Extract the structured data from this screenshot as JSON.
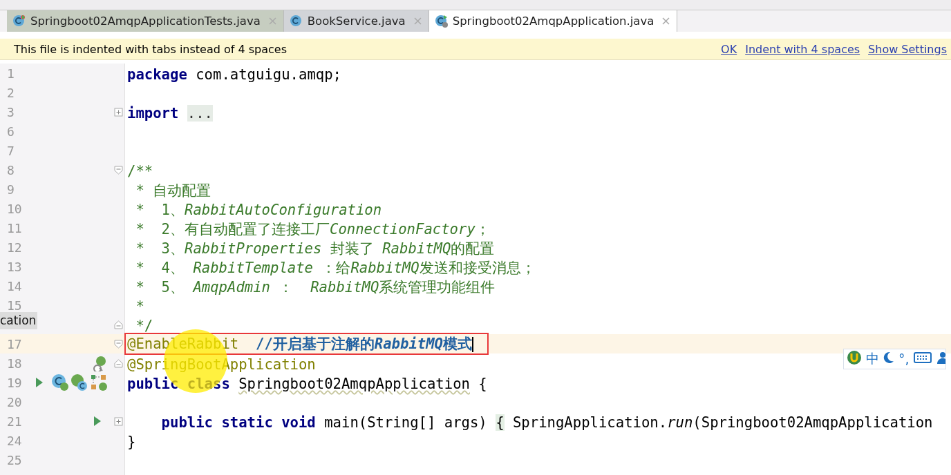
{
  "tabs": [
    {
      "label": "Springboot02AmqpApplicationTests.java",
      "selected": false
    },
    {
      "label": "BookService.java",
      "selected": false
    },
    {
      "label": "Springboot02AmqpApplication.java",
      "selected": true
    }
  ],
  "banner": {
    "message": "This file is indented with tabs instead of 4 spaces",
    "links": [
      "OK",
      "Indent with 4 spaces",
      "Show Settings"
    ]
  },
  "tooltip": {
    "text": "cation"
  },
  "lines": [
    {
      "number": "1",
      "tokens": [
        {
          "kind": "keyword",
          "text": "package"
        },
        {
          "kind": "plain",
          "text": " com.atguigu.amqp;"
        }
      ]
    },
    {
      "number": "2"
    },
    {
      "number": "3",
      "collapsed": true,
      "tokens": [
        {
          "kind": "keyword",
          "text": "import "
        },
        {
          "kind": "folded",
          "text": "..."
        }
      ]
    },
    {
      "number": "6"
    },
    {
      "number": "7"
    },
    {
      "number": "8",
      "fold_open": true,
      "tokens": [
        {
          "kind": "doc",
          "text": "/**"
        }
      ]
    },
    {
      "number": "9",
      "tokens": [
        {
          "kind": "doc",
          "text": " * 自动配置"
        }
      ]
    },
    {
      "number": "10",
      "tokens": [
        {
          "kind": "doc",
          "text": " *  1、"
        },
        {
          "kind": "doc-italic",
          "text": "RabbitAutoConfiguration"
        }
      ]
    },
    {
      "number": "11",
      "tokens": [
        {
          "kind": "doc",
          "text": " *  2、有自动配置了连接工厂"
        },
        {
          "kind": "doc-italic",
          "text": "ConnectionFactory"
        },
        {
          "kind": "doc",
          "text": "；"
        }
      ]
    },
    {
      "number": "12",
      "tokens": [
        {
          "kind": "doc",
          "text": " *  3、"
        },
        {
          "kind": "doc-italic",
          "text": "RabbitProperties"
        },
        {
          "kind": "doc",
          "text": " 封装了 "
        },
        {
          "kind": "doc-italic",
          "text": "RabbitMQ"
        },
        {
          "kind": "doc",
          "text": "的配置"
        }
      ]
    },
    {
      "number": "13",
      "tokens": [
        {
          "kind": "doc",
          "text": " *  4、 "
        },
        {
          "kind": "doc-italic",
          "text": "RabbitTemplate"
        },
        {
          "kind": "doc",
          "text": " ：给"
        },
        {
          "kind": "doc-italic",
          "text": "RabbitMQ"
        },
        {
          "kind": "doc",
          "text": "发送和接受消息；"
        }
      ]
    },
    {
      "number": "14",
      "tokens": [
        {
          "kind": "doc",
          "text": " *  5、 "
        },
        {
          "kind": "doc-italic",
          "text": "AmqpAdmin"
        },
        {
          "kind": "doc",
          "text": " ：  "
        },
        {
          "kind": "doc-italic",
          "text": "RabbitMQ"
        },
        {
          "kind": "doc",
          "text": "系统管理功能组件"
        }
      ]
    },
    {
      "number": "15",
      "tokens": [
        {
          "kind": "doc",
          "text": " *"
        }
      ]
    },
    {
      "fold_close": true,
      "tokens": [
        {
          "kind": "doc",
          "text": " */"
        }
      ]
    },
    {
      "number": "17",
      "fold_open": true,
      "current": true,
      "boxed": true,
      "tokens": [
        {
          "kind": "annotation",
          "text": "@EnableRabbit  "
        },
        {
          "kind": "comment",
          "text": "//开启基于注解的"
        },
        {
          "kind": "comment-italic",
          "text": "RabbitMQ"
        },
        {
          "kind": "comment",
          "text": "模式"
        }
      ]
    },
    {
      "number": "18",
      "fold_close": true,
      "gutter": [
        {
          "kind": "bean"
        }
      ],
      "tokens": [
        {
          "kind": "annotation",
          "text": "@SpringBootApplication"
        }
      ]
    },
    {
      "number": "19",
      "gutter": [
        {
          "kind": "run"
        },
        {
          "kind": "class-bean"
        },
        {
          "kind": "bean-class"
        },
        {
          "kind": "diagram"
        }
      ],
      "tokens": [
        {
          "kind": "keyword",
          "text": "public class "
        },
        {
          "kind": "warn",
          "text": "Springboot02AmqpApplication"
        },
        {
          "kind": "plain",
          "text": " {"
        }
      ]
    },
    {
      "number": "20"
    },
    {
      "number": "21",
      "collapsed": true,
      "gutter": [
        {
          "kind": "run"
        }
      ],
      "tokens": [
        {
          "kind": "keyword",
          "text": "    public static void"
        },
        {
          "kind": "plain",
          "text": " main(String[] args) "
        },
        {
          "kind": "brace",
          "text": "{"
        },
        {
          "kind": "plain",
          "text": " SpringApplication."
        },
        {
          "kind": "italic",
          "text": "run"
        },
        {
          "kind": "plain",
          "text": "(Springboot02AmqpApplication"
        }
      ]
    },
    {
      "number": "24",
      "tokens": [
        {
          "kind": "plain",
          "text": "}"
        }
      ]
    },
    {
      "number": "25"
    }
  ],
  "ime": {
    "items": [
      "中",
      "°,"
    ]
  }
}
